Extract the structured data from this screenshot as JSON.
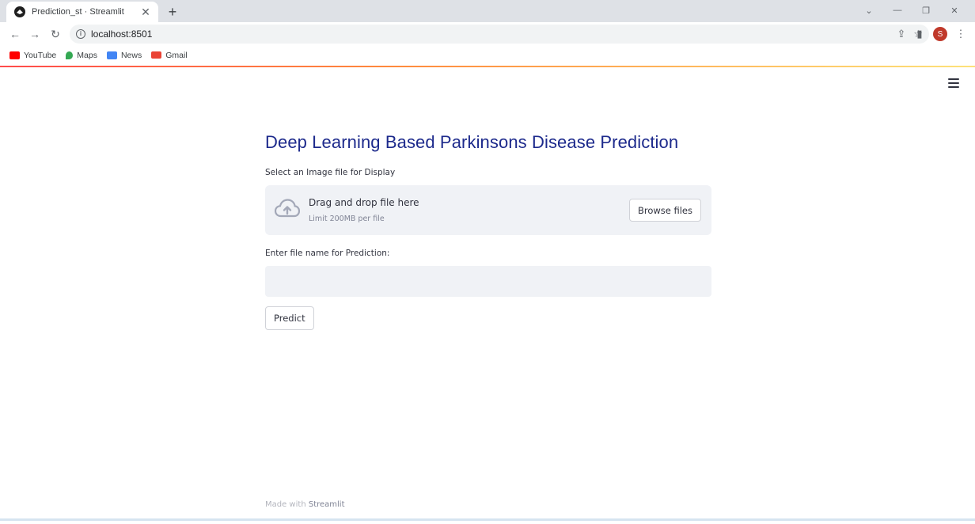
{
  "browser": {
    "tab_title": "Prediction_st · Streamlit",
    "url": "localhost:8501",
    "avatar_letter": "S",
    "bookmarks": [
      {
        "label": "YouTube",
        "icon": "youtube-icon",
        "color": "#ff0000"
      },
      {
        "label": "Maps",
        "icon": "maps-icon",
        "color": "#34a853"
      },
      {
        "label": "News",
        "icon": "news-icon",
        "color": "#4285f4"
      },
      {
        "label": "Gmail",
        "icon": "gmail-icon",
        "color": "#ea4335"
      }
    ]
  },
  "app": {
    "title": "Deep Learning Based Parkinsons Disease Prediction",
    "upload_label": "Select an Image file for Display",
    "dropzone_title": "Drag and drop file here",
    "dropzone_limit": "Limit 200MB per file",
    "browse_label": "Browse files",
    "filename_label": "Enter file name for Prediction:",
    "filename_value": "",
    "predict_label": "Predict",
    "footer_prefix": "Made with ",
    "footer_link": "Streamlit",
    "accent_color": "#1d2a8c"
  }
}
